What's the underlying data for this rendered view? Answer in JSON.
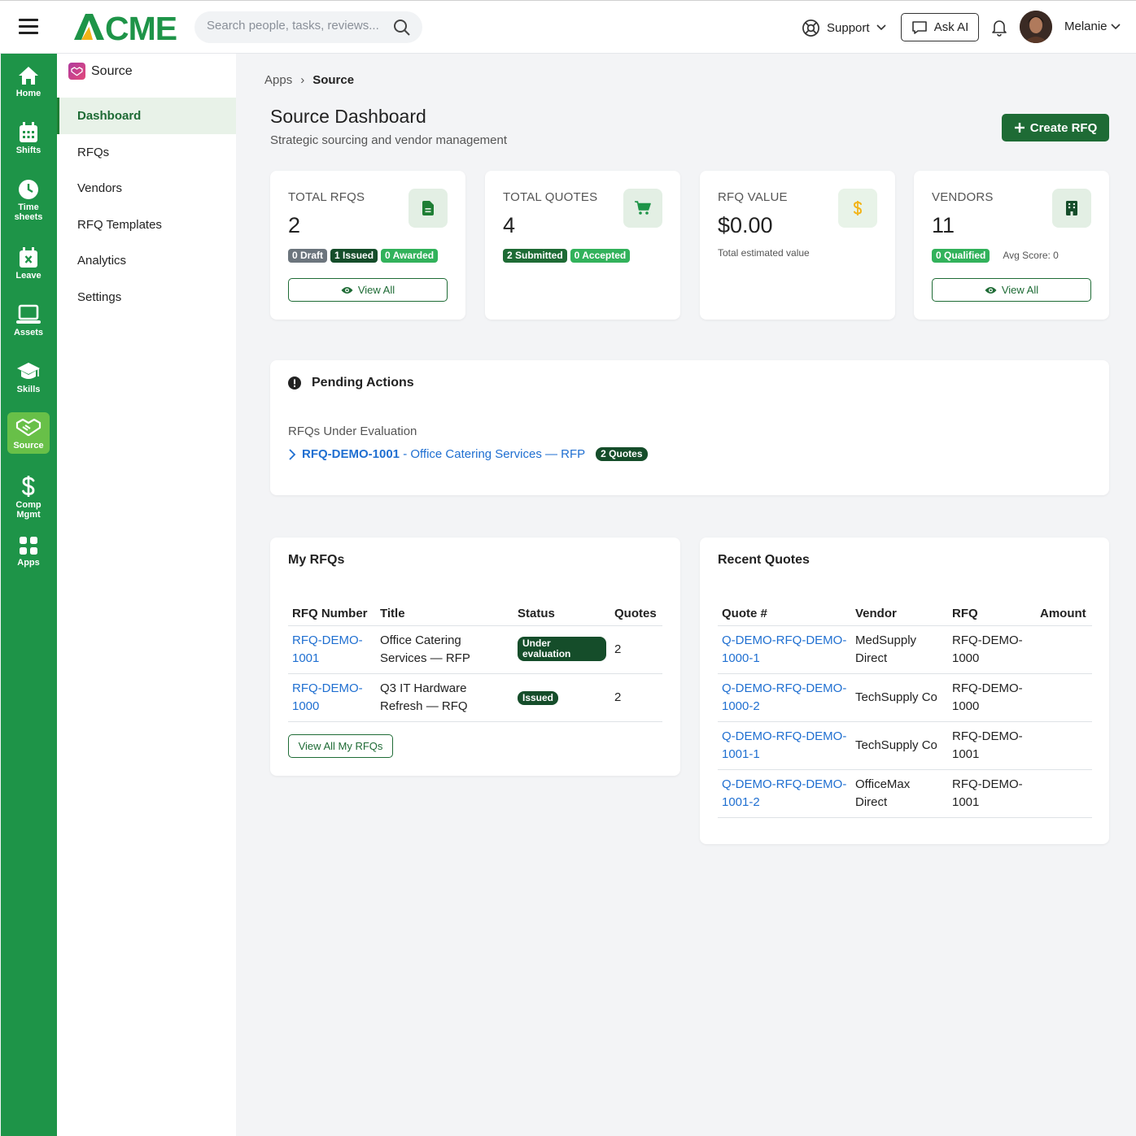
{
  "header": {
    "logo_text": "ACME",
    "search_placeholder": "Search people, tasks, reviews...",
    "support_label": "Support",
    "ask_ai_label": "Ask AI",
    "user_name": "Melanie"
  },
  "rail": {
    "items": [
      {
        "label": "Home",
        "icon": "home-icon"
      },
      {
        "label": "Shifts",
        "icon": "calendar-icon"
      },
      {
        "label": "Time sheets",
        "icon": "clock-icon"
      },
      {
        "label": "Leave",
        "icon": "calendar-x-icon"
      },
      {
        "label": "Assets",
        "icon": "laptop-icon"
      },
      {
        "label": "Skills",
        "icon": "graduation-cap-icon"
      },
      {
        "label": "Source",
        "icon": "handshake-icon",
        "active": true
      },
      {
        "label": "Comp Mgmt",
        "icon": "dollar-icon"
      },
      {
        "label": "Apps",
        "icon": "grid-icon"
      }
    ]
  },
  "subnav": {
    "app_name": "Source",
    "items": [
      "Dashboard",
      "RFQs",
      "Vendors",
      "RFQ Templates",
      "Analytics",
      "Settings"
    ],
    "active": "Dashboard"
  },
  "breadcrumb": {
    "parent": "Apps",
    "separator": "›",
    "current": "Source"
  },
  "page": {
    "title": "Source Dashboard",
    "subtitle": "Strategic sourcing and vendor management",
    "create_button": "Create RFQ"
  },
  "stats": {
    "rfqs": {
      "label": "TOTAL RFQS",
      "value": "2",
      "badges": [
        "0 Draft",
        "1 Issued",
        "0 Awarded"
      ],
      "button": "View All"
    },
    "quotes": {
      "label": "TOTAL QUOTES",
      "value": "4",
      "badges": [
        "2 Submitted",
        "0 Accepted"
      ]
    },
    "value": {
      "label": "RFQ VALUE",
      "value": "$0.00",
      "note": "Total estimated value"
    },
    "vendors": {
      "label": "VENDORS",
      "value": "11",
      "badge": "0 Qualified",
      "avg": "Avg Score: 0",
      "button": "View All"
    }
  },
  "pending": {
    "title": "Pending Actions",
    "subtitle": "RFQs Under Evaluation",
    "item_id": "RFQ-DEMO-1001",
    "item_title": " - Office Catering Services — RFP",
    "item_badge": "2 Quotes"
  },
  "my_rfqs": {
    "title": "My RFQs",
    "columns": [
      "RFQ Number",
      "Title",
      "Status",
      "Quotes"
    ],
    "rows": [
      {
        "number": "RFQ-DEMO-1001",
        "title": "Office Catering Services — RFP",
        "status": "Under evaluation",
        "quotes": "2"
      },
      {
        "number": "RFQ-DEMO-1000",
        "title": "Q3 IT Hardware Refresh — RFQ",
        "status": "Issued",
        "quotes": "2"
      }
    ],
    "view_all": "View All My RFQs"
  },
  "recent_quotes": {
    "title": "Recent Quotes",
    "columns": [
      "Quote #",
      "Vendor",
      "RFQ",
      "Amount"
    ],
    "rows": [
      {
        "quote": "Q-DEMO-RFQ-DEMO-1000-1",
        "vendor": "MedSupply Direct",
        "rfq": "RFQ-DEMO-1000",
        "amount": ""
      },
      {
        "quote": "Q-DEMO-RFQ-DEMO-1000-2",
        "vendor": "TechSupply Co",
        "rfq": "RFQ-DEMO-1000",
        "amount": ""
      },
      {
        "quote": "Q-DEMO-RFQ-DEMO-1001-1",
        "vendor": "TechSupply Co",
        "rfq": "RFQ-DEMO-1001",
        "amount": ""
      },
      {
        "quote": "Q-DEMO-RFQ-DEMO-1001-2",
        "vendor": "OfficeMax Direct",
        "rfq": "RFQ-DEMO-1001",
        "amount": ""
      }
    ]
  },
  "colors": {
    "brand_green": "#1e9448",
    "dark_green": "#1e6b35",
    "link_blue": "#1f6fd1",
    "active_rail": "#68c048"
  }
}
